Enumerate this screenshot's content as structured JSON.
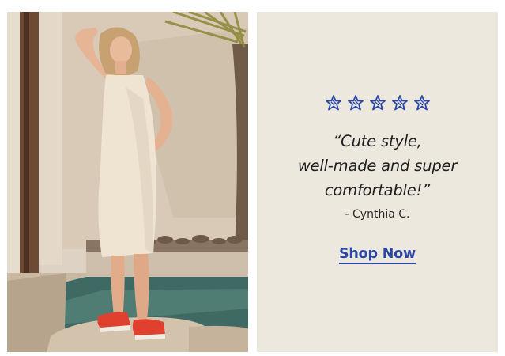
{
  "hero": {
    "image": "photo",
    "image_alt": "model-in-cream-sleeveless-midi-dress-and-red-flats"
  },
  "review": {
    "rating": 5,
    "rating_max": 5,
    "star_icon": "hand-drawn-star-icon",
    "star_color": "#2a47a6",
    "quote_lines": [
      "“Cute style,",
      "well-made and super",
      "comfortable!”"
    ],
    "author": "- Cynthia C.",
    "background": "#ede8de"
  },
  "cta": {
    "label": "Shop Now",
    "color": "#2a47a6"
  }
}
